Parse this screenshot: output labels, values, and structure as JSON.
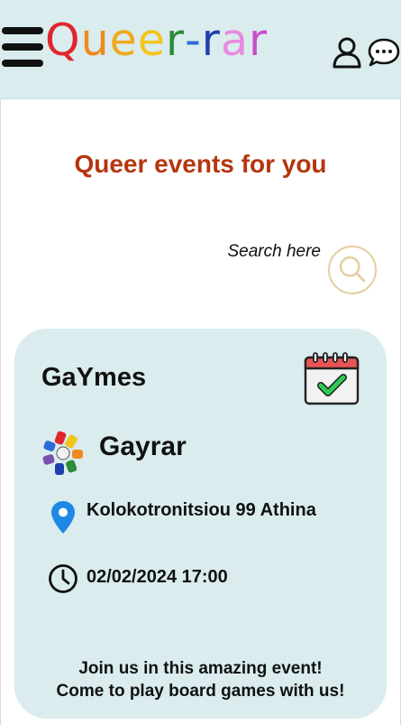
{
  "header": {
    "logo_letters": [
      {
        "char": "Q",
        "color": "#e0262b"
      },
      {
        "char": "u",
        "color": "#f08a1c"
      },
      {
        "char": "e",
        "color": "#f0a81c"
      },
      {
        "char": "e",
        "color": "#f4c41a"
      },
      {
        "char": "r",
        "color": "#2f8a3a"
      },
      {
        "char": "-",
        "color": "#2b6ad8"
      },
      {
        "char": "r",
        "color": "#1f3fb0"
      },
      {
        "char": "a",
        "color": "#e889e0"
      },
      {
        "char": "r",
        "color": "#c94fc9"
      }
    ],
    "icons": {
      "menu": "hamburger-menu-icon",
      "user": "user-icon",
      "chat": "chat-icon"
    }
  },
  "main": {
    "title": "Queer events for you",
    "search": {
      "label": "Search here",
      "icon": "search-icon"
    }
  },
  "event": {
    "title": "GaYmes",
    "organizer": "Gayrar",
    "address": "Kolokotronitsiou 99 Athina",
    "datetime": "02/02/2024 17:00",
    "description_lines": [
      "Join us in this amazing event!",
      "Come to play board games with us!"
    ],
    "icons": {
      "calendar": "calendar-check-icon",
      "location": "location-pin-icon",
      "time": "clock-icon"
    }
  },
  "colors": {
    "header_bg": "#daeced",
    "card_bg": "#daeced",
    "title_color": "#b5360e",
    "search_ring": "#e3cfa0",
    "pin_color": "#1e88e5",
    "calendar_top": "#e85454",
    "check_green": "#2ecc55"
  }
}
